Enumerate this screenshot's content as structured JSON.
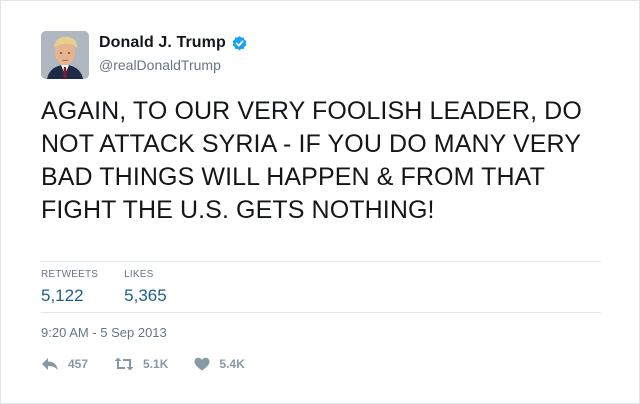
{
  "tweet": {
    "author": {
      "name": "Donald J. Trump",
      "handle": "@realDonaldTrump",
      "verified": true
    },
    "text": "AGAIN, TO OUR VERY FOOLISH LEADER, DO NOT ATTACK SYRIA - IF YOU DO MANY VERY BAD THINGS WILL HAPPEN & FROM THAT FIGHT THE U.S. GETS NOTHING!",
    "stats": {
      "retweets_label": "RETWEETS",
      "retweets_value": "5,122",
      "likes_label": "LIKES",
      "likes_value": "5,365"
    },
    "timestamp": "9:20 AM - 5 Sep 2013",
    "actions": {
      "reply_count": "457",
      "retweet_count": "5.1K",
      "like_count": "5.4K"
    }
  },
  "colors": {
    "text": "#14171a",
    "muted": "#657786",
    "verified": "#1da1f2",
    "stat_value": "#1c5f8b",
    "action_icon": "#8899a6",
    "divider": "#e1e8ed"
  },
  "icons": {
    "verified": "verified-badge-icon",
    "reply": "reply-icon",
    "retweet": "retweet-icon",
    "like": "heart-icon"
  }
}
